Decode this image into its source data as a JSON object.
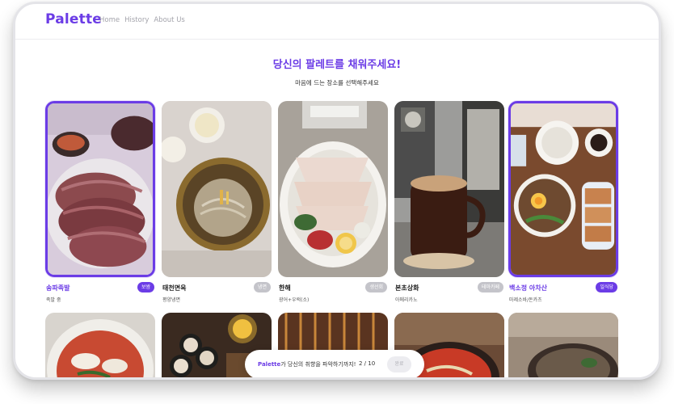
{
  "nav": {
    "logo": "Palette",
    "links": [
      "Home",
      "History",
      "About Us"
    ]
  },
  "main": {
    "headline": "당신의 팔레트를 채워주세요!",
    "subline": "마음에 드는 장소를 선택해주세요"
  },
  "cards": [
    {
      "title": "송파족발",
      "badge": "보쌈",
      "sub": "족발 중",
      "selected": true
    },
    {
      "title": "태천면옥",
      "badge": "냉면",
      "sub": "평양냉면",
      "selected": false
    },
    {
      "title": "한해",
      "badge": "생선회",
      "sub": "광어+우럭(소)",
      "selected": false
    },
    {
      "title": "본초상화",
      "badge": "테마카페",
      "sub": "아메리카노",
      "selected": false
    },
    {
      "title": "백소정 아차산",
      "badge": "일식당",
      "sub": "마제소바/돈카츠",
      "selected": true
    }
  ],
  "progress": {
    "brand": "Palette",
    "message": "가 당신의 취향을 파악하기까지!",
    "count": "2 / 10",
    "done_label": "완료"
  },
  "colors": {
    "accent": "#6b3ce6",
    "inactive_badge": "#c4c4ca"
  }
}
